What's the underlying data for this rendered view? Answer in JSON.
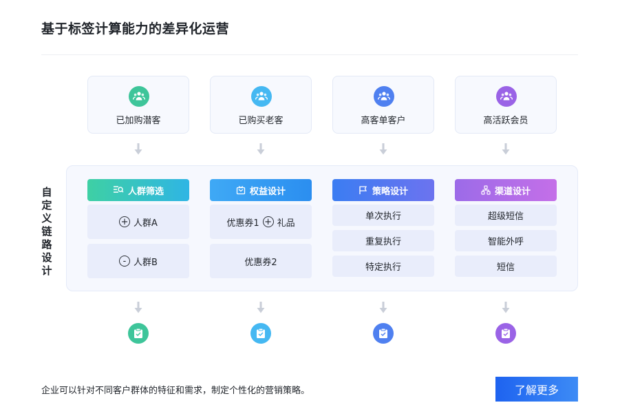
{
  "title": "基于标签计算能力的差异化运营",
  "segments": [
    {
      "label": "已加购潜客",
      "icon": "group-icon",
      "color": "#3ec59a"
    },
    {
      "label": "已购买老客",
      "icon": "group-icon",
      "color": "#45b8f2"
    },
    {
      "label": "高客单客户",
      "icon": "group-icon",
      "color": "#4f80f0"
    },
    {
      "label": "高活跃会员",
      "icon": "group-icon",
      "color": "#9a63e6"
    }
  ],
  "side_label": "自定义链路设计",
  "columns": [
    {
      "header": "人群筛选",
      "icon": "filter-icon",
      "color_from": "#3ed0a4",
      "color_to": "#2fb5e4",
      "items": [
        {
          "symbol": "+",
          "text": "人群A"
        },
        {
          "symbol": "-",
          "text": "人群B"
        }
      ]
    },
    {
      "header": "权益设计",
      "icon": "gift-icon",
      "color_from": "#3fa9f5",
      "color_to": "#2b8ef0",
      "items": [
        {
          "text": "优惠券1",
          "symbol": "+",
          "text2": "礼品"
        },
        {
          "text": "优惠券2"
        }
      ]
    },
    {
      "header": "策略设计",
      "icon": "flag-icon",
      "color_from": "#3b7df2",
      "color_to": "#6c73ef",
      "items": [
        {
          "text": "单次执行"
        },
        {
          "text": "重复执行"
        },
        {
          "text": "特定执行"
        }
      ]
    },
    {
      "header": "渠道设计",
      "icon": "channel-icon",
      "color_from": "#9c6be8",
      "color_to": "#c46fe8",
      "items": [
        {
          "text": "超级短信"
        },
        {
          "text": "智能外呼"
        },
        {
          "text": "短信"
        }
      ]
    }
  ],
  "results": [
    {
      "icon": "clipboard-check-icon",
      "color": "#3ec59a"
    },
    {
      "icon": "clipboard-check-icon",
      "color": "#45b8f2"
    },
    {
      "icon": "clipboard-check-icon",
      "color": "#4f80f0"
    },
    {
      "icon": "clipboard-check-icon",
      "color": "#9a63e6"
    }
  ],
  "footer": {
    "description": "企业可以针对不同客户群体的特征和需求，制定个性化的营销策略。",
    "cta_label": "了解更多"
  }
}
